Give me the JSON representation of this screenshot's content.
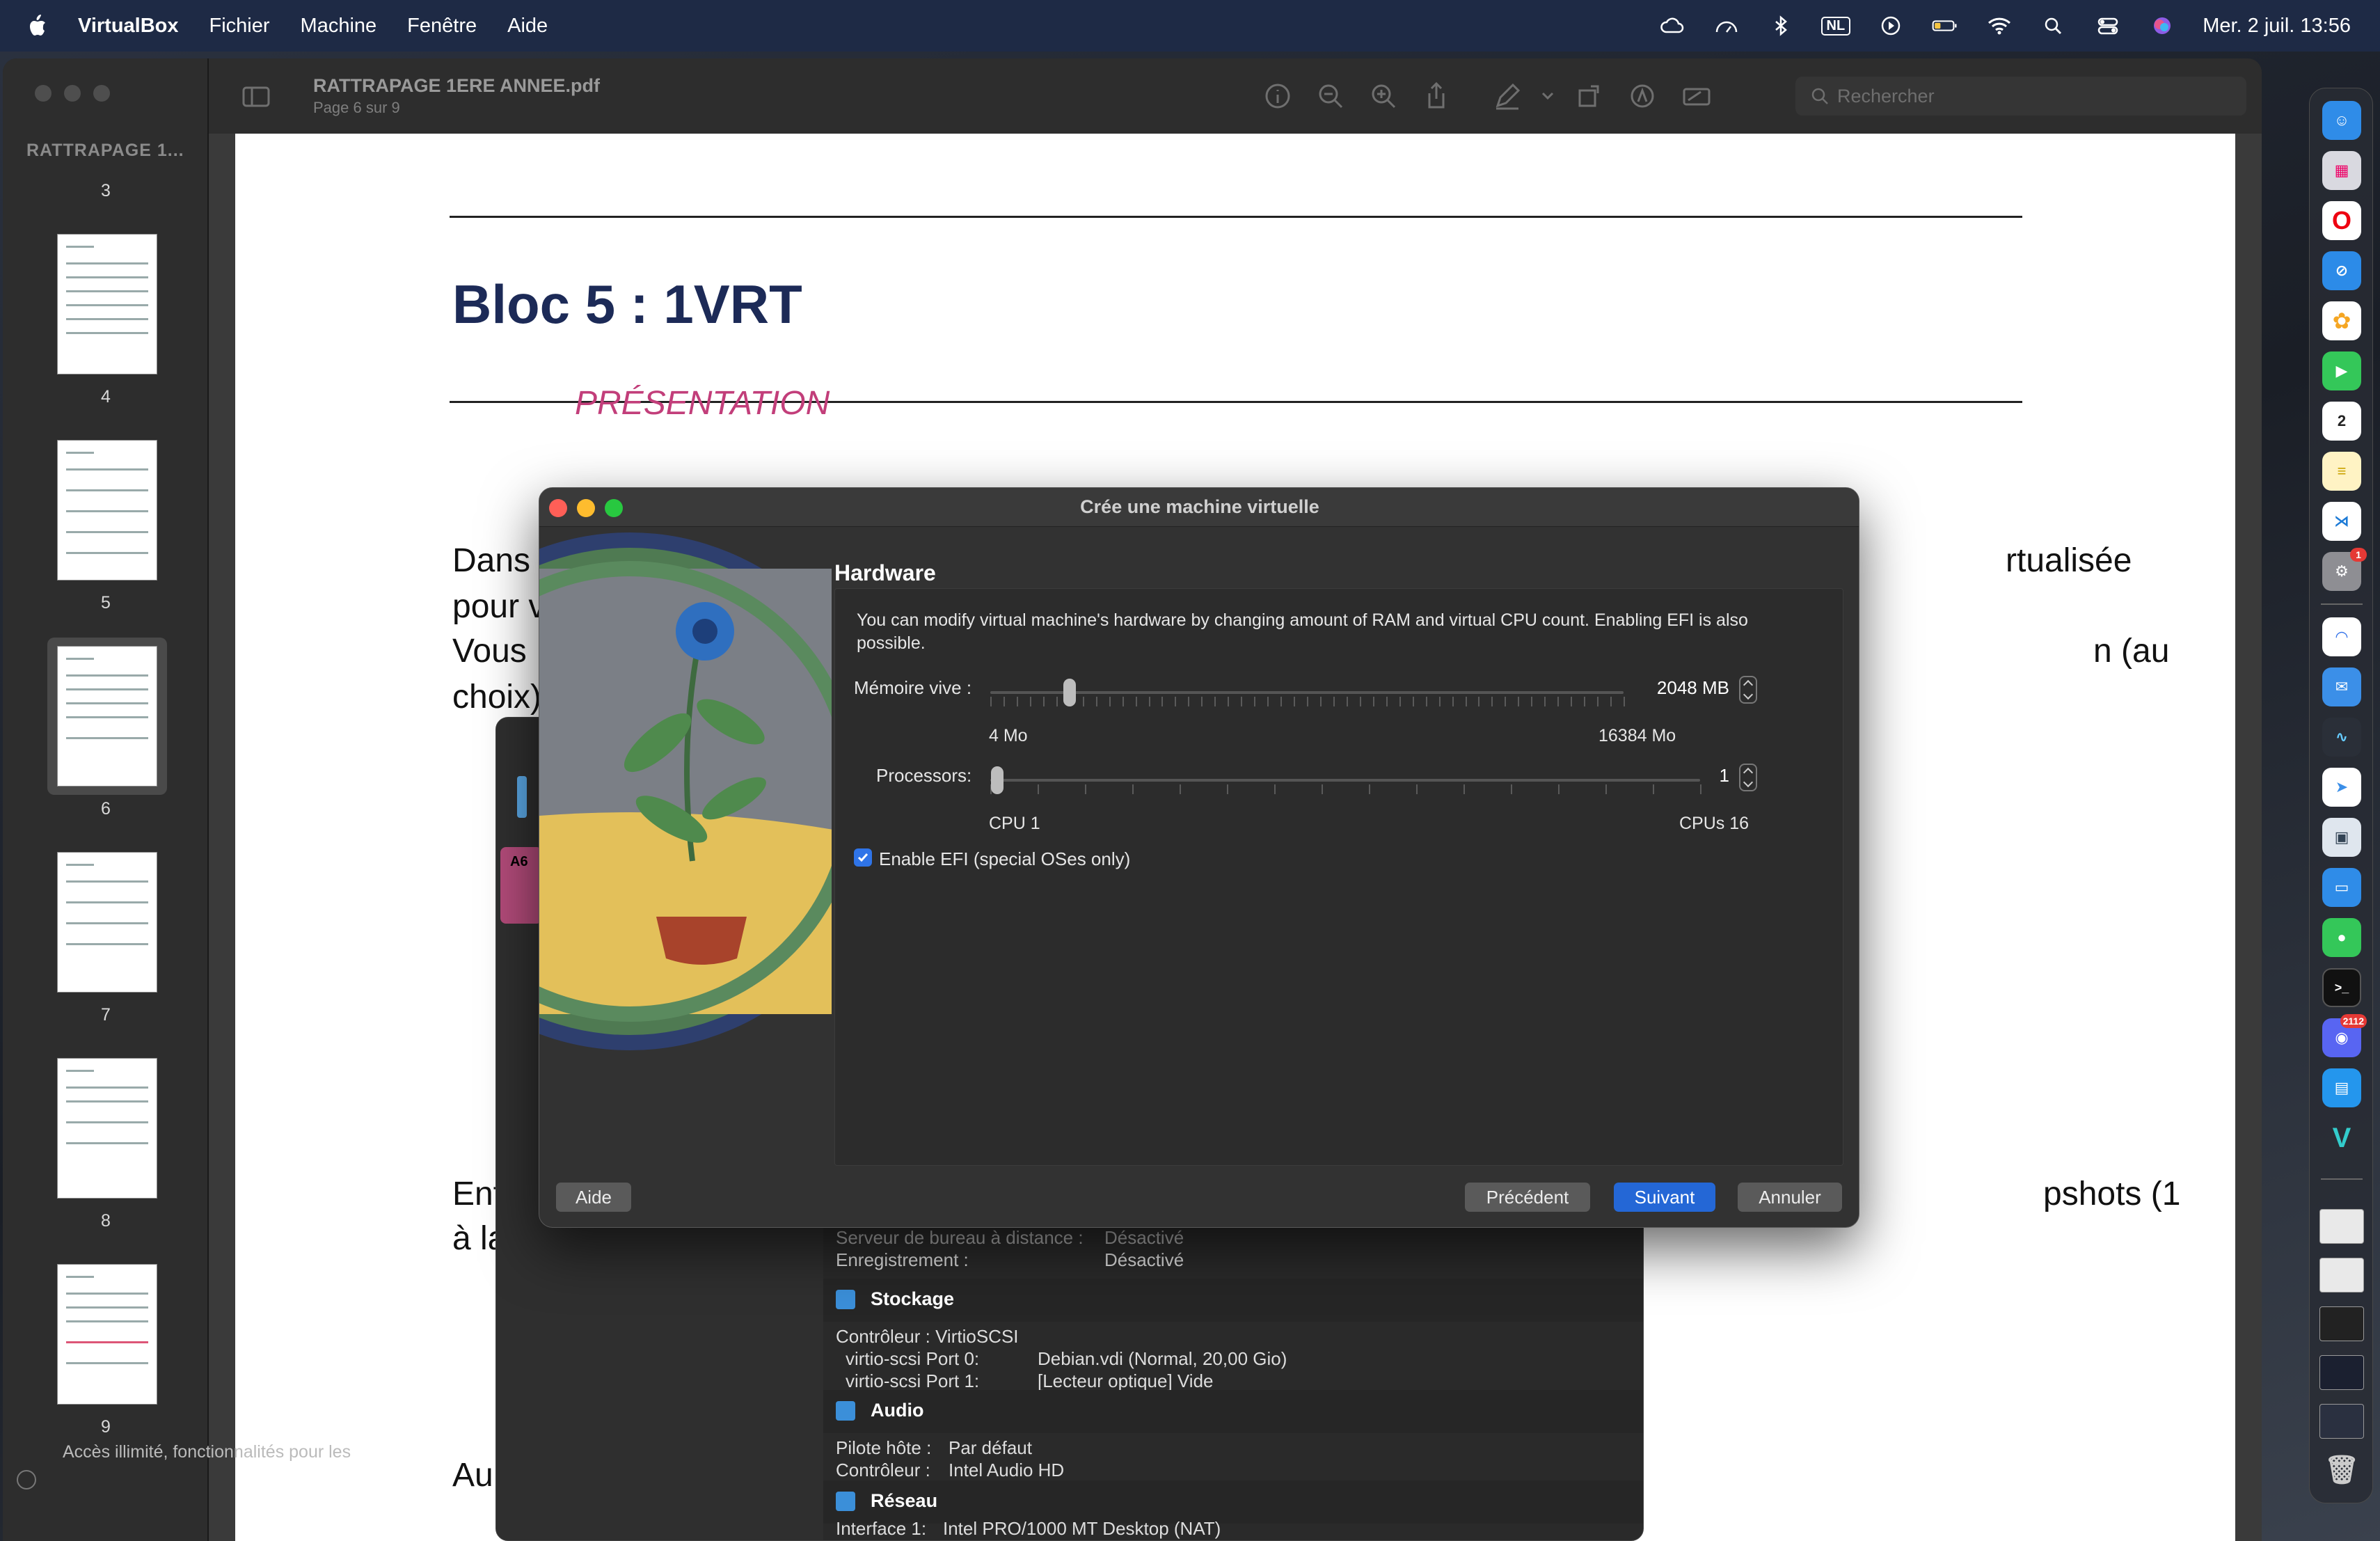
{
  "menubar": {
    "app_name": "VirtualBox",
    "menus": [
      "Fichier",
      "Machine",
      "Fenêtre",
      "Aide"
    ],
    "keyboard_layout": "NL",
    "datetime": "Mer. 2 juil.  13:56"
  },
  "preview": {
    "sidebar_title": "RATTRAPAGE 1...",
    "pages": [
      "3",
      "4",
      "5",
      "6",
      "7",
      "8",
      "9"
    ],
    "selected_page": "6",
    "doc_title": "RATTRAPAGE 1ERE ANNEE.pdf",
    "doc_subtitle": "Page 6 sur 9",
    "search_placeholder": "Rechercher",
    "sidebar_note": "Accès illimité, fonctionnalités pour les",
    "toolbar_icons": [
      "sidebar-icon",
      "info-icon",
      "zoom-out-icon",
      "zoom-in-icon",
      "share-icon",
      "markup-icon",
      "rotate-icon",
      "annotate-icon",
      "form-icon"
    ]
  },
  "pdf": {
    "heading": "Bloc 5 : 1VRT",
    "subheading": "PRÉSENTATION",
    "line1_left": "Dans",
    "line1_right": "rtualisée",
    "line2_left": "pour v",
    "line3_left": "Vous",
    "line3_right": "n (au",
    "line4_left": "choix)",
    "line5_left": "Ent",
    "line5_right": "pshots (1",
    "line6_left": "à la",
    "line7_left": "Au"
  },
  "manager": {
    "vm_icon_label": "A6",
    "rows_top": [
      {
        "label": "Serveur de bureau à distance :",
        "value": "Désactivé"
      },
      {
        "label": "Enregistrement :",
        "value": "Désactivé"
      }
    ],
    "storage": {
      "title": "Stockage",
      "controller": "Contrôleur : VirtioSCSI",
      "port0_label": "virtio-scsi Port 0:",
      "port0_value": "Debian.vdi (Normal, 20,00 Gio)",
      "port1_label": "virtio-scsi Port 1:",
      "port1_value": "[Lecteur optique] Vide"
    },
    "audio": {
      "title": "Audio",
      "host_driver_label": "Pilote hôte :",
      "host_driver_value": "Par défaut",
      "controller_label": "Contrôleur :",
      "controller_value": "Intel Audio HD"
    },
    "network": {
      "title": "Réseau",
      "interface_label": "Interface 1:",
      "interface_value": "Intel PRO/1000 MT Desktop (NAT)"
    }
  },
  "dialog": {
    "title": "Crée une machine virtuelle",
    "section_title": "Hardware",
    "description": "You can modify virtual machine's hardware by changing amount of RAM and virtual CPU count. Enabling EFI is also possible.",
    "memory": {
      "label": "Mémoire vive :",
      "value": "2048 MB",
      "min_label": "4 Mo",
      "max_label": "16384 Mo",
      "fraction": 0.125
    },
    "processors": {
      "label": "Processors:",
      "value": "1",
      "min_label": "CPU 1",
      "max_label": "CPUs 16",
      "fraction": 0.0
    },
    "efi": {
      "label": "Enable EFI (special OSes only)",
      "checked": true
    },
    "buttons": {
      "help": "Aide",
      "back": "Précédent",
      "next": "Suivant",
      "cancel": "Annuler"
    }
  },
  "dock": {
    "apps": [
      "Finder",
      "Launchpad",
      "Opera",
      "Safari",
      "Photos",
      "FaceTime",
      "Calendar",
      "Notes",
      "VS Code",
      "System Settings",
      "Arc",
      "Mail",
      "Activity",
      "Maps",
      "Preview",
      "Keynote",
      "Messages",
      "Terminal",
      "Discord",
      "Docker",
      "VirtualBox"
    ],
    "calendar_day": "2",
    "discord_badge": "2112",
    "colors": {
      "accent": "#2467d6",
      "heading": "#1c2a57",
      "subheading": "#c23e7a"
    }
  }
}
